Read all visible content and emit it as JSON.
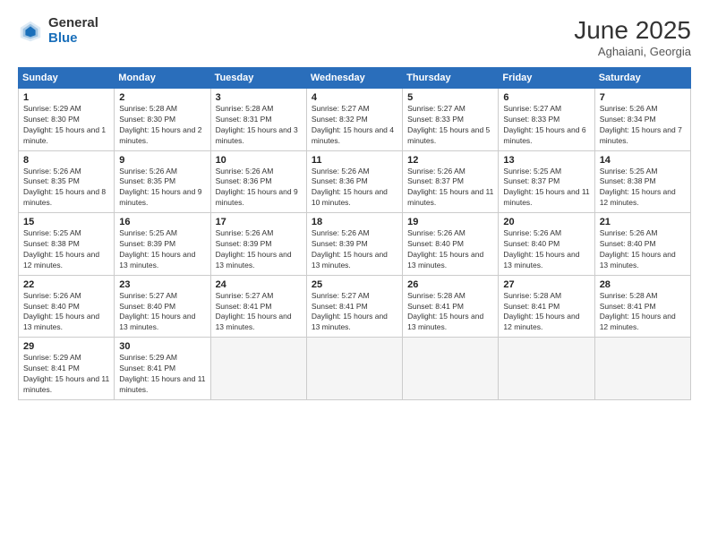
{
  "logo": {
    "general": "General",
    "blue": "Blue"
  },
  "title": {
    "month": "June 2025",
    "location": "Aghaiani, Georgia"
  },
  "headers": [
    "Sunday",
    "Monday",
    "Tuesday",
    "Wednesday",
    "Thursday",
    "Friday",
    "Saturday"
  ],
  "weeks": [
    [
      {
        "day": "1",
        "sunrise": "Sunrise: 5:29 AM",
        "sunset": "Sunset: 8:30 PM",
        "daylight": "Daylight: 15 hours and 1 minute."
      },
      {
        "day": "2",
        "sunrise": "Sunrise: 5:28 AM",
        "sunset": "Sunset: 8:30 PM",
        "daylight": "Daylight: 15 hours and 2 minutes."
      },
      {
        "day": "3",
        "sunrise": "Sunrise: 5:28 AM",
        "sunset": "Sunset: 8:31 PM",
        "daylight": "Daylight: 15 hours and 3 minutes."
      },
      {
        "day": "4",
        "sunrise": "Sunrise: 5:27 AM",
        "sunset": "Sunset: 8:32 PM",
        "daylight": "Daylight: 15 hours and 4 minutes."
      },
      {
        "day": "5",
        "sunrise": "Sunrise: 5:27 AM",
        "sunset": "Sunset: 8:33 PM",
        "daylight": "Daylight: 15 hours and 5 minutes."
      },
      {
        "day": "6",
        "sunrise": "Sunrise: 5:27 AM",
        "sunset": "Sunset: 8:33 PM",
        "daylight": "Daylight: 15 hours and 6 minutes."
      },
      {
        "day": "7",
        "sunrise": "Sunrise: 5:26 AM",
        "sunset": "Sunset: 8:34 PM",
        "daylight": "Daylight: 15 hours and 7 minutes."
      }
    ],
    [
      {
        "day": "8",
        "sunrise": "Sunrise: 5:26 AM",
        "sunset": "Sunset: 8:35 PM",
        "daylight": "Daylight: 15 hours and 8 minutes."
      },
      {
        "day": "9",
        "sunrise": "Sunrise: 5:26 AM",
        "sunset": "Sunset: 8:35 PM",
        "daylight": "Daylight: 15 hours and 9 minutes."
      },
      {
        "day": "10",
        "sunrise": "Sunrise: 5:26 AM",
        "sunset": "Sunset: 8:36 PM",
        "daylight": "Daylight: 15 hours and 9 minutes."
      },
      {
        "day": "11",
        "sunrise": "Sunrise: 5:26 AM",
        "sunset": "Sunset: 8:36 PM",
        "daylight": "Daylight: 15 hours and 10 minutes."
      },
      {
        "day": "12",
        "sunrise": "Sunrise: 5:26 AM",
        "sunset": "Sunset: 8:37 PM",
        "daylight": "Daylight: 15 hours and 11 minutes."
      },
      {
        "day": "13",
        "sunrise": "Sunrise: 5:25 AM",
        "sunset": "Sunset: 8:37 PM",
        "daylight": "Daylight: 15 hours and 11 minutes."
      },
      {
        "day": "14",
        "sunrise": "Sunrise: 5:25 AM",
        "sunset": "Sunset: 8:38 PM",
        "daylight": "Daylight: 15 hours and 12 minutes."
      }
    ],
    [
      {
        "day": "15",
        "sunrise": "Sunrise: 5:25 AM",
        "sunset": "Sunset: 8:38 PM",
        "daylight": "Daylight: 15 hours and 12 minutes."
      },
      {
        "day": "16",
        "sunrise": "Sunrise: 5:25 AM",
        "sunset": "Sunset: 8:39 PM",
        "daylight": "Daylight: 15 hours and 13 minutes."
      },
      {
        "day": "17",
        "sunrise": "Sunrise: 5:26 AM",
        "sunset": "Sunset: 8:39 PM",
        "daylight": "Daylight: 15 hours and 13 minutes."
      },
      {
        "day": "18",
        "sunrise": "Sunrise: 5:26 AM",
        "sunset": "Sunset: 8:39 PM",
        "daylight": "Daylight: 15 hours and 13 minutes."
      },
      {
        "day": "19",
        "sunrise": "Sunrise: 5:26 AM",
        "sunset": "Sunset: 8:40 PM",
        "daylight": "Daylight: 15 hours and 13 minutes."
      },
      {
        "day": "20",
        "sunrise": "Sunrise: 5:26 AM",
        "sunset": "Sunset: 8:40 PM",
        "daylight": "Daylight: 15 hours and 13 minutes."
      },
      {
        "day": "21",
        "sunrise": "Sunrise: 5:26 AM",
        "sunset": "Sunset: 8:40 PM",
        "daylight": "Daylight: 15 hours and 13 minutes."
      }
    ],
    [
      {
        "day": "22",
        "sunrise": "Sunrise: 5:26 AM",
        "sunset": "Sunset: 8:40 PM",
        "daylight": "Daylight: 15 hours and 13 minutes."
      },
      {
        "day": "23",
        "sunrise": "Sunrise: 5:27 AM",
        "sunset": "Sunset: 8:40 PM",
        "daylight": "Daylight: 15 hours and 13 minutes."
      },
      {
        "day": "24",
        "sunrise": "Sunrise: 5:27 AM",
        "sunset": "Sunset: 8:41 PM",
        "daylight": "Daylight: 15 hours and 13 minutes."
      },
      {
        "day": "25",
        "sunrise": "Sunrise: 5:27 AM",
        "sunset": "Sunset: 8:41 PM",
        "daylight": "Daylight: 15 hours and 13 minutes."
      },
      {
        "day": "26",
        "sunrise": "Sunrise: 5:28 AM",
        "sunset": "Sunset: 8:41 PM",
        "daylight": "Daylight: 15 hours and 13 minutes."
      },
      {
        "day": "27",
        "sunrise": "Sunrise: 5:28 AM",
        "sunset": "Sunset: 8:41 PM",
        "daylight": "Daylight: 15 hours and 12 minutes."
      },
      {
        "day": "28",
        "sunrise": "Sunrise: 5:28 AM",
        "sunset": "Sunset: 8:41 PM",
        "daylight": "Daylight: 15 hours and 12 minutes."
      }
    ],
    [
      {
        "day": "29",
        "sunrise": "Sunrise: 5:29 AM",
        "sunset": "Sunset: 8:41 PM",
        "daylight": "Daylight: 15 hours and 11 minutes."
      },
      {
        "day": "30",
        "sunrise": "Sunrise: 5:29 AM",
        "sunset": "Sunset: 8:41 PM",
        "daylight": "Daylight: 15 hours and 11 minutes."
      },
      null,
      null,
      null,
      null,
      null
    ]
  ]
}
